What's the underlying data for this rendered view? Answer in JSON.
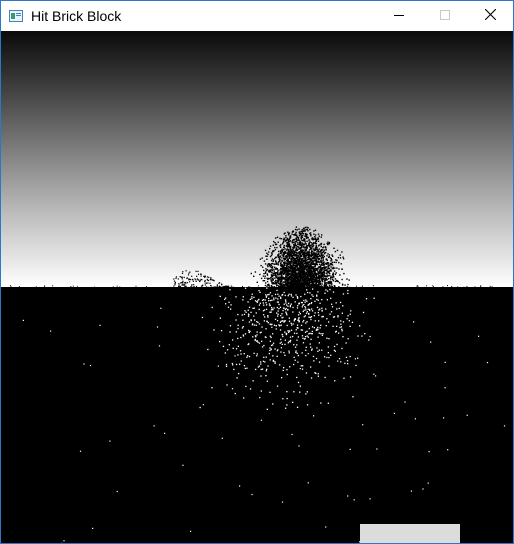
{
  "window": {
    "title": "Hit Brick Block",
    "icon": "window-app-icon",
    "controls": {
      "minimize_icon": "minimize-icon",
      "maximize_icon": "maximize-icon",
      "close_icon": "close-icon"
    }
  },
  "game": {
    "sky_gradient": [
      "#0a0a0a",
      "#ffffff"
    ],
    "ground_color": "#000000",
    "particle_color_sky": "#000000",
    "particle_color_ground": "#ffffff",
    "paddle_color": "#dcdcdc"
  }
}
